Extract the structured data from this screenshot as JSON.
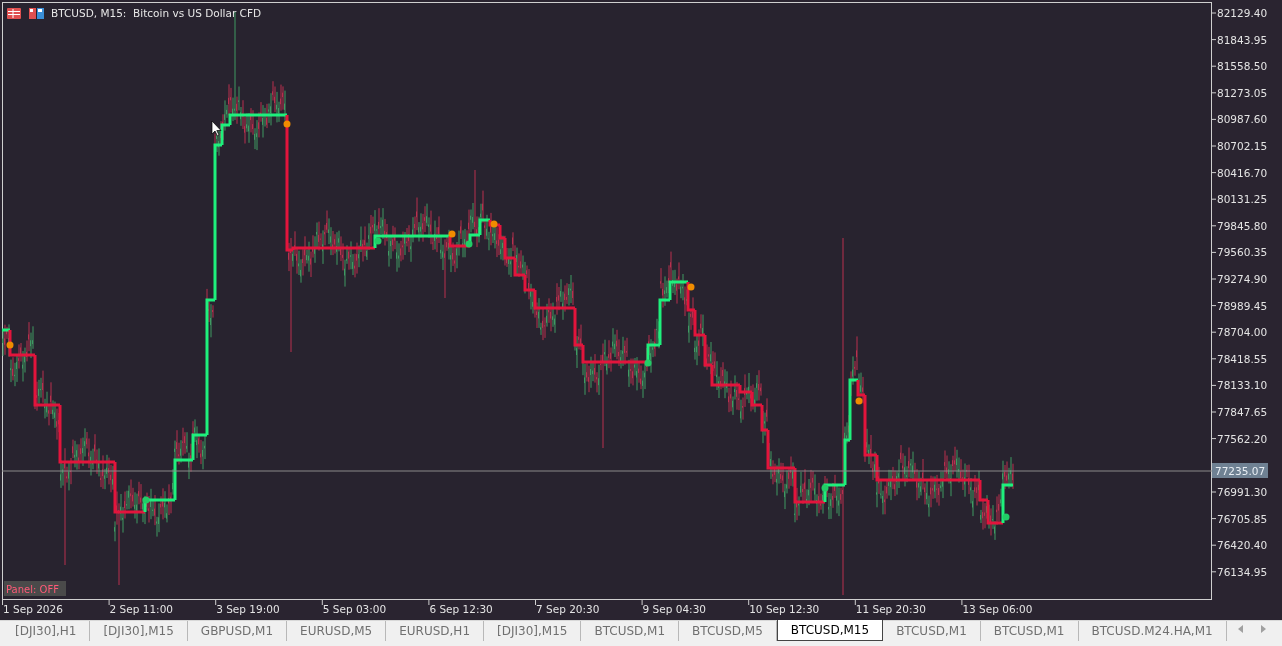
{
  "chart": {
    "title": "BTCUSD, M15:  Bitcoin vs US Dollar CFD",
    "panel_button": "Panel: OFF",
    "price_label": "77235.07",
    "y_axis_labels_above_price": [
      "82129.40",
      "81843.95",
      "81558.50",
      "81273.05",
      "80987.60",
      "80702.15",
      "80416.70",
      "80131.25",
      "79845.80",
      "79560.35",
      "79274.90",
      "78989.45",
      "78704.00",
      "78418.55",
      "78133.10",
      "77847.65",
      "77562.20"
    ],
    "y_axis_labels_below_price": [
      "76991.30",
      "76705.85",
      "76420.40",
      "76134.95"
    ],
    "x_axis_labels": [
      "1 Sep 2026",
      "2 Sep 11:00",
      "3 Sep 19:00",
      "5 Sep 03:00",
      "6 Sep 12:30",
      "7 Sep 20:30",
      "9 Sep 04:30",
      "10 Sep 12:30",
      "11 Sep 20:30",
      "13 Sep 06:00"
    ]
  },
  "tabs": [
    {
      "label": "[DJI30],H1",
      "selected": false
    },
    {
      "label": "[DJI30],M15",
      "selected": false
    },
    {
      "label": "GBPUSD,M1",
      "selected": false
    },
    {
      "label": "EURUSD,M5",
      "selected": false
    },
    {
      "label": "EURUSD,H1",
      "selected": false
    },
    {
      "label": "[DJI30],M15",
      "selected": false
    },
    {
      "label": "BTCUSD,M1",
      "selected": false
    },
    {
      "label": "BTCUSD,M5",
      "selected": false
    },
    {
      "label": "BTCUSD,M15",
      "selected": true
    },
    {
      "label": "BTCUSD,M1",
      "selected": false
    },
    {
      "label": "BTCUSD,M1",
      "selected": false
    },
    {
      "label": "BTCUSD.M24.HA,M1",
      "selected": false
    }
  ]
}
